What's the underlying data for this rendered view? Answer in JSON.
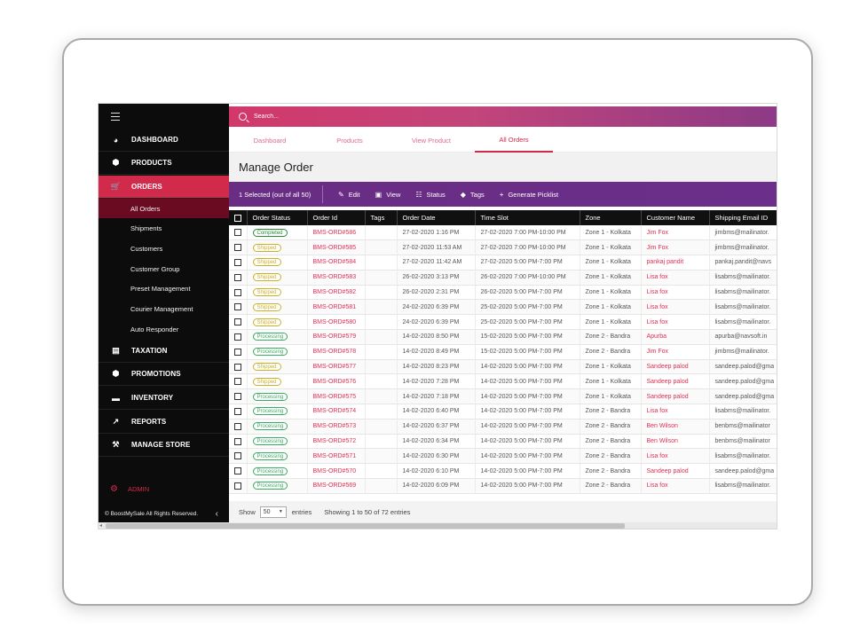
{
  "sidebar": {
    "nav": [
      {
        "label": "DASHBOARD",
        "icon": "dashboard-icon",
        "active": false
      },
      {
        "label": "PRODUCTS",
        "icon": "box-icon",
        "active": false
      },
      {
        "label": "ORDERS",
        "icon": "cart-icon",
        "active": true
      },
      {
        "label": "TAXATION",
        "icon": "receipt-icon",
        "active": false
      },
      {
        "label": "PROMOTIONS",
        "icon": "gift-icon",
        "active": false
      },
      {
        "label": "INVENTORY",
        "icon": "folder-icon",
        "active": false
      },
      {
        "label": "REPORTS",
        "icon": "chart-icon",
        "active": false
      },
      {
        "label": "MANAGE STORE",
        "icon": "store-icon",
        "active": false
      }
    ],
    "orders_sub": [
      {
        "label": "All Orders",
        "active": true
      },
      {
        "label": "Shipments",
        "active": false
      },
      {
        "label": "Customers",
        "active": false
      },
      {
        "label": "Customer Group",
        "active": false
      },
      {
        "label": "Preset Management",
        "active": false
      },
      {
        "label": "Courier Management",
        "active": false
      },
      {
        "label": "Auto Responder",
        "active": false
      }
    ],
    "admin_label": "ADMIN",
    "copyright": "© BoostMySale All Rights Reserved."
  },
  "search": {
    "placeholder": "Search..."
  },
  "tabs": [
    {
      "label": "Dashboard",
      "active": false
    },
    {
      "label": "Products",
      "active": false
    },
    {
      "label": "View Product",
      "active": false
    },
    {
      "label": "All Orders",
      "active": true
    }
  ],
  "page_title": "Manage Order",
  "action_bar": {
    "selection": "1 Selected (out of all 50)",
    "actions": [
      {
        "label": "Edit",
        "icon": "pencil-icon"
      },
      {
        "label": "View",
        "icon": "view-icon"
      },
      {
        "label": "Status",
        "icon": "sliders-icon"
      },
      {
        "label": "Tags",
        "icon": "tag-icon"
      },
      {
        "label": "Generate Picklist",
        "icon": "plus-icon"
      }
    ]
  },
  "table": {
    "columns": [
      "Order Status",
      "Order Id",
      "Tags",
      "Order Date",
      "Time Slot",
      "Zone",
      "Customer Name",
      "Shipping Email ID"
    ],
    "rows": [
      {
        "status": "Completed",
        "id": "BMS-ORD#586",
        "tags": "",
        "date": "27-02-2020 1:16 PM",
        "slot": "27-02-2020 7:00 PM-10:00 PM",
        "zone": "Zone 1 - Kolkata",
        "customer": "Jim Fox",
        "email": "jimbms@mailinator."
      },
      {
        "status": "Shipped",
        "id": "BMS-ORD#585",
        "tags": "",
        "date": "27-02-2020 11:53 AM",
        "slot": "27-02-2020 7:00 PM-10:00 PM",
        "zone": "Zone 1 - Kolkata",
        "customer": "Jim Fox",
        "email": "jimbms@mailinator."
      },
      {
        "status": "Shipped",
        "id": "BMS-ORD#584",
        "tags": "",
        "date": "27-02-2020 11:42 AM",
        "slot": "27-02-2020 5:00 PM-7:00 PM",
        "zone": "Zone 1 - Kolkata",
        "customer": "pankaj pandit",
        "email": "pankaj.pandit@navs"
      },
      {
        "status": "Shipped",
        "id": "BMS-ORD#583",
        "tags": "",
        "date": "26-02-2020 3:13 PM",
        "slot": "26-02-2020 7:00 PM-10:00 PM",
        "zone": "Zone 1 - Kolkata",
        "customer": "Lisa fox",
        "email": "lisabms@mailinator."
      },
      {
        "status": "Shipped",
        "id": "BMS-ORD#582",
        "tags": "",
        "date": "26-02-2020 2:31 PM",
        "slot": "26-02-2020 5:00 PM-7:00 PM",
        "zone": "Zone 1 - Kolkata",
        "customer": "Lisa fox",
        "email": "lisabms@mailinator."
      },
      {
        "status": "Shipped",
        "id": "BMS-ORD#581",
        "tags": "",
        "date": "24-02-2020 6:39 PM",
        "slot": "25-02-2020 5:00 PM-7:00 PM",
        "zone": "Zone 1 - Kolkata",
        "customer": "Lisa fox",
        "email": "lisabms@mailinator."
      },
      {
        "status": "Shipped",
        "id": "BMS-ORD#580",
        "tags": "",
        "date": "24-02-2020 6:39 PM",
        "slot": "25-02-2020 5:00 PM-7:00 PM",
        "zone": "Zone 1 - Kolkata",
        "customer": "Lisa fox",
        "email": "lisabms@mailinator."
      },
      {
        "status": "Processing",
        "id": "BMS-ORD#579",
        "tags": "",
        "date": "14-02-2020 8:50 PM",
        "slot": "15-02-2020 5:00 PM-7:00 PM",
        "zone": "Zone 2 - Bandra",
        "customer": "Apurba",
        "email": "apurba@navsoft.in"
      },
      {
        "status": "Processing",
        "id": "BMS-ORD#578",
        "tags": "",
        "date": "14-02-2020 8:49 PM",
        "slot": "15-02-2020 5:00 PM-7:00 PM",
        "zone": "Zone 2 - Bandra",
        "customer": "Jim Fox",
        "email": "jimbms@mailinator."
      },
      {
        "status": "Shipped",
        "id": "BMS-ORD#577",
        "tags": "",
        "date": "14-02-2020 8:23 PM",
        "slot": "14-02-2020 5:00 PM-7:00 PM",
        "zone": "Zone 1 - Kolkata",
        "customer": "Sandeep palod",
        "email": "sandeep.palod@gma"
      },
      {
        "status": "Shipped",
        "id": "BMS-ORD#576",
        "tags": "",
        "date": "14-02-2020 7:28 PM",
        "slot": "14-02-2020 5:00 PM-7:00 PM",
        "zone": "Zone 1 - Kolkata",
        "customer": "Sandeep palod",
        "email": "sandeep.palod@gma"
      },
      {
        "status": "Processing",
        "id": "BMS-ORD#575",
        "tags": "",
        "date": "14-02-2020 7:18 PM",
        "slot": "14-02-2020 5:00 PM-7:00 PM",
        "zone": "Zone 1 - Kolkata",
        "customer": "Sandeep palod",
        "email": "sandeep.palod@gma"
      },
      {
        "status": "Processing",
        "id": "BMS-ORD#574",
        "tags": "",
        "date": "14-02-2020 6:40 PM",
        "slot": "14-02-2020 5:00 PM-7:00 PM",
        "zone": "Zone 2 - Bandra",
        "customer": "Lisa fox",
        "email": "lisabms@mailinator."
      },
      {
        "status": "Processing",
        "id": "BMS-ORD#573",
        "tags": "",
        "date": "14-02-2020 6:37 PM",
        "slot": "14-02-2020 5:00 PM-7:00 PM",
        "zone": "Zone 2 - Bandra",
        "customer": "Ben Wilson",
        "email": "benbms@mailinator"
      },
      {
        "status": "Processing",
        "id": "BMS-ORD#572",
        "tags": "",
        "date": "14-02-2020 6:34 PM",
        "slot": "14-02-2020 5:00 PM-7:00 PM",
        "zone": "Zone 2 - Bandra",
        "customer": "Ben Wilson",
        "email": "benbms@mailinator"
      },
      {
        "status": "Processing",
        "id": "BMS-ORD#571",
        "tags": "",
        "date": "14-02-2020 6:30 PM",
        "slot": "14-02-2020 5:00 PM-7:00 PM",
        "zone": "Zone 2 - Bandra",
        "customer": "Lisa fox",
        "email": "lisabms@mailinator."
      },
      {
        "status": "Processing",
        "id": "BMS-ORD#570",
        "tags": "",
        "date": "14-02-2020 6:10 PM",
        "slot": "14-02-2020 5:00 PM-7:00 PM",
        "zone": "Zone 2 - Bandra",
        "customer": "Sandeep palod",
        "email": "sandeep.palod@gma"
      },
      {
        "status": "Processing",
        "id": "BMS-ORD#569",
        "tags": "",
        "date": "14-02-2020 6:09 PM",
        "slot": "14-02-2020 5:00 PM-7:00 PM",
        "zone": "Zone 2 - Bandra",
        "customer": "Lisa fox",
        "email": "lisabms@mailinator."
      }
    ]
  },
  "footer": {
    "show_label": "Show",
    "page_size": "50",
    "entries_label": "entries",
    "info": "Showing 1 to 50 of 72 entries"
  },
  "colors": {
    "accent": "#d12a4a",
    "action_bar": "#6a2d84",
    "sidebar_bg": "#0c0c0c"
  }
}
